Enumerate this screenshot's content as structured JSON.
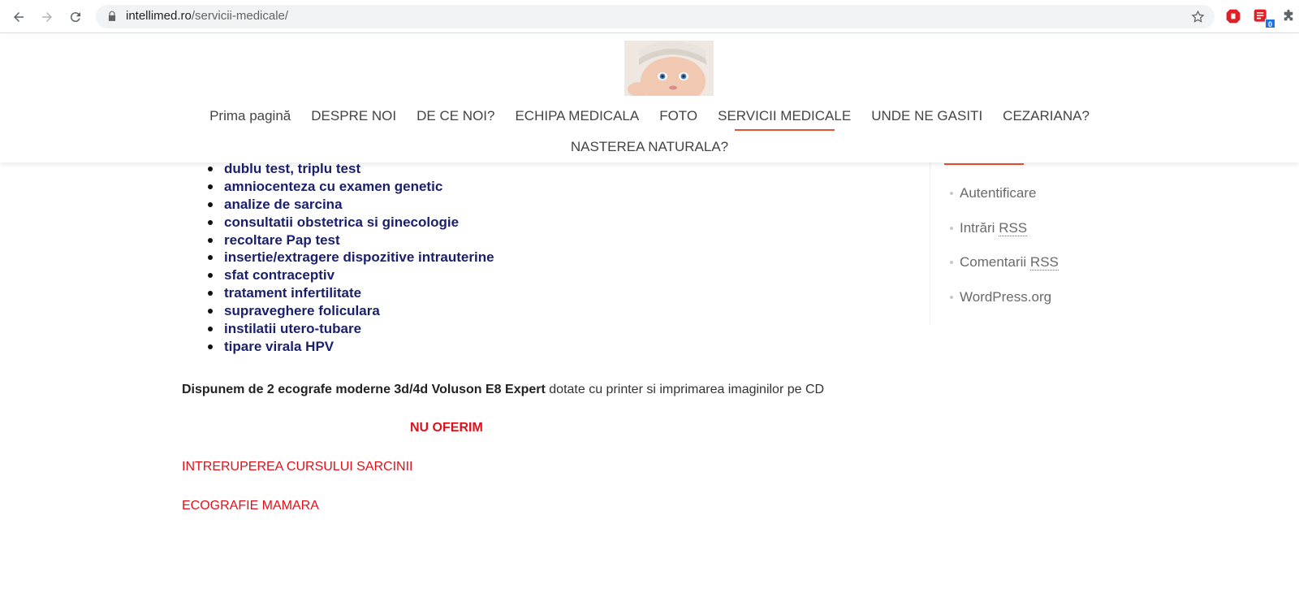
{
  "browser": {
    "url_host": "intellimed.ro",
    "url_path": "/servicii-medicale/",
    "extension_badge": "0"
  },
  "header": {
    "menu": [
      {
        "label": "Prima pagină"
      },
      {
        "label": "DESPRE NOI"
      },
      {
        "label": "DE CE NOI?"
      },
      {
        "label": "ECHIPA MEDICALA"
      },
      {
        "label": "FOTO"
      },
      {
        "label": "SERVICII MEDICALE",
        "active": true
      },
      {
        "label": "UNDE NE GASITI"
      },
      {
        "label": "CEZARIANA?"
      },
      {
        "label": "NASTEREA NATURALA?"
      }
    ]
  },
  "content": {
    "services": [
      "dublu test, triplu test",
      "amniocenteza cu examen genetic",
      "analize de sarcina",
      "consultatii obstetrica si ginecologie",
      "recoltare Pap test",
      "insertie/extragere dispozitive intrauterine",
      "sfat contraceptiv",
      "tratament infertilitate",
      "supraveghere foliculara",
      "instilatii utero-tubare",
      "tipare virala HPV"
    ],
    "ecografe_bold": "Dispunem de 2 ecografe moderne  3d/4d Voluson E8 Expert",
    "ecografe_rest": " dotate cu printer  si imprimarea imaginilor pe CD",
    "nu_oferim": "NU OFERIM",
    "not_offered": [
      "INTRERUPEREA CURSULUI SARCINII",
      "ECOGRAFIE MAMARA"
    ]
  },
  "sidebar": {
    "links": [
      {
        "label": "Autentificare"
      },
      {
        "prefix": "Intrări ",
        "abbr": "RSS"
      },
      {
        "prefix": "Comentarii ",
        "abbr": "RSS"
      },
      {
        "label": "WordPress.org"
      }
    ]
  },
  "colors": {
    "accent": "#e8532f",
    "service_text": "#1a1f6b",
    "warning_red": "#e0101a"
  }
}
